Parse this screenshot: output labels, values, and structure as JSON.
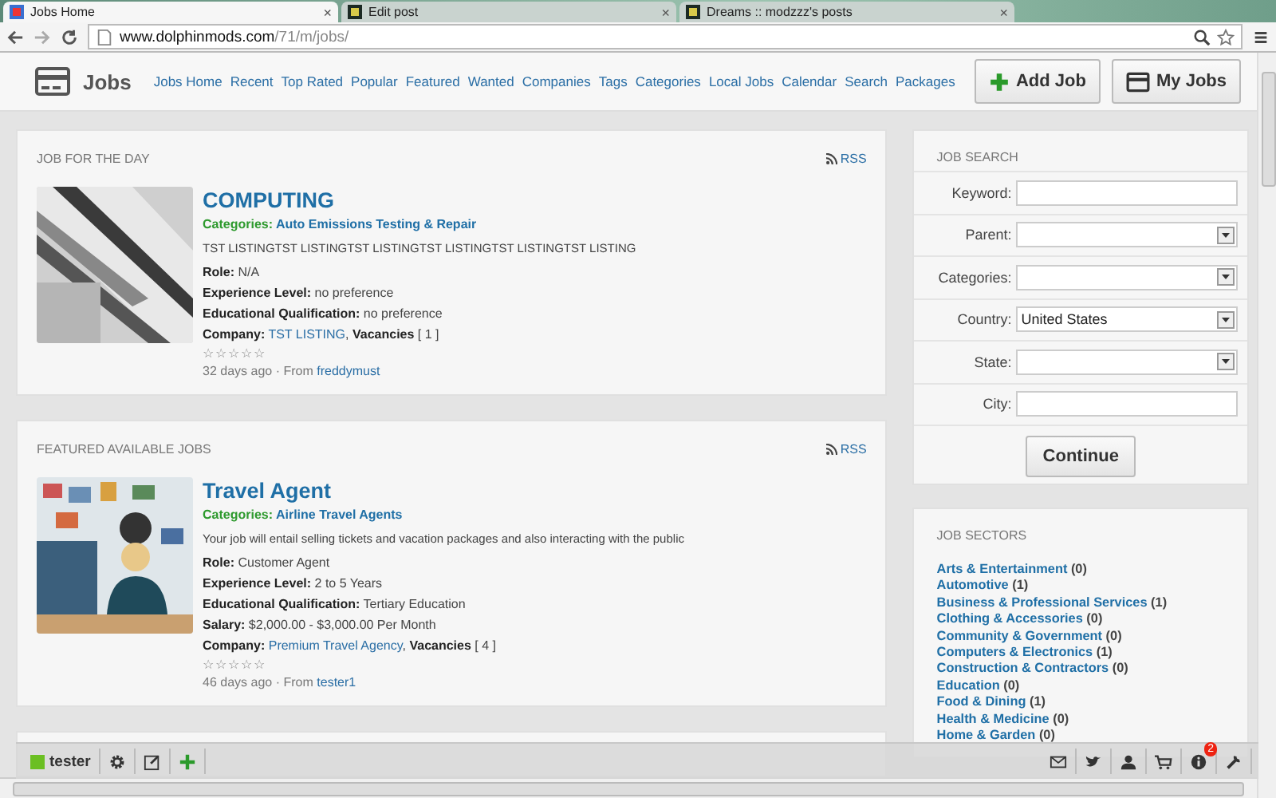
{
  "browser": {
    "tabs": [
      {
        "label": "Jobs Home",
        "selected": true,
        "close": "×"
      },
      {
        "label": "Edit post",
        "selected": false,
        "close": "×"
      },
      {
        "label": "Dreams :: modzzz's posts",
        "selected": false,
        "close": "×"
      }
    ],
    "address": {
      "host": "www.dolphinmods.com",
      "path": "/71/m/jobs/"
    }
  },
  "header": {
    "title": "Jobs",
    "nav": [
      "Jobs Home",
      "Recent",
      "Top Rated",
      "Popular",
      "Featured",
      "Wanted",
      "Companies",
      "Tags",
      "Categories",
      "Local Jobs",
      "Calendar",
      "Search",
      "Packages"
    ],
    "buttons": [
      {
        "label": "Add Job",
        "kind": "add"
      },
      {
        "label": "My Jobs",
        "kind": "card"
      }
    ]
  },
  "sections": [
    {
      "title": "JOB FOR THE DAY",
      "rss": "RSS",
      "jobs": [
        {
          "title": "COMPUTING",
          "categories_label": "Categories:",
          "category": "Auto Emissions Testing & Repair",
          "description": "TST LISTINGTST LISTINGTST LISTINGTST LISTINGTST LISTINGTST LISTING",
          "fields": [
            {
              "label": "Role:",
              "value": "N/A"
            },
            {
              "label": "Experience Level:",
              "value": "no preference"
            },
            {
              "label": "Educational Qualification:",
              "value": "no preference"
            }
          ],
          "company_label": "Company:",
          "company": "TST LISTING",
          "company_sep": ",",
          "vacancies_label": "Vacancies",
          "vacancies": "[ 1 ]",
          "stars": 0,
          "age": "32 days ago",
          "meta_sep": "·",
          "from_label": "From",
          "author": "freddymust"
        }
      ]
    },
    {
      "title": "FEATURED AVAILABLE JOBS",
      "rss": "RSS",
      "jobs": [
        {
          "title": "Travel Agent",
          "categories_label": "Categories:",
          "category": "Airline Travel Agents",
          "description": "Your job will entail selling tickets and vacation packages and also interacting with the public",
          "fields": [
            {
              "label": "Role:",
              "value": "Customer Agent"
            },
            {
              "label": "Experience Level:",
              "value": "2 to 5 Years"
            },
            {
              "label": "Educational Qualification:",
              "value": "Tertiary Education"
            },
            {
              "label": "Salary:",
              "value": "$2,000.00 - $3,000.00 Per Month"
            }
          ],
          "company_label": "Company:",
          "company": "Premium Travel Agency",
          "company_sep": ",",
          "vacancies_label": "Vacancies",
          "vacancies": "[ 4 ]",
          "stars": 0,
          "age": "46 days ago",
          "meta_sep": "·",
          "from_label": "From",
          "author": "tester1"
        }
      ]
    }
  ],
  "search": {
    "title": "JOB SEARCH",
    "fields": [
      {
        "label": "Keyword:",
        "kind": "text"
      },
      {
        "label": "Parent:",
        "kind": "select"
      },
      {
        "label": "Categories:",
        "kind": "select"
      },
      {
        "label": "Country:",
        "kind": "select",
        "value": "United States"
      },
      {
        "label": "State:",
        "kind": "select"
      },
      {
        "label": "City:",
        "kind": "text"
      }
    ],
    "button": "Continue"
  },
  "sectors": {
    "title": "JOB SECTORS",
    "items": [
      {
        "name": "Arts & Entertainment",
        "count": "(0)"
      },
      {
        "name": "Automotive",
        "count": "(1)"
      },
      {
        "name": "Business & Professional Services",
        "count": "(1)"
      },
      {
        "name": "Clothing & Accessories",
        "count": "(0)"
      },
      {
        "name": "Community & Government",
        "count": "(0)"
      },
      {
        "name": "Computers & Electronics",
        "count": "(1)"
      },
      {
        "name": "Construction & Contractors",
        "count": "(0)"
      },
      {
        "name": "Education",
        "count": "(0)"
      },
      {
        "name": "Food & Dining",
        "count": "(1)"
      },
      {
        "name": "Health & Medicine",
        "count": "(0)"
      },
      {
        "name": "Home & Garden",
        "count": "(0)"
      }
    ]
  },
  "toolbar": {
    "user": "tester",
    "notifications": "2"
  }
}
